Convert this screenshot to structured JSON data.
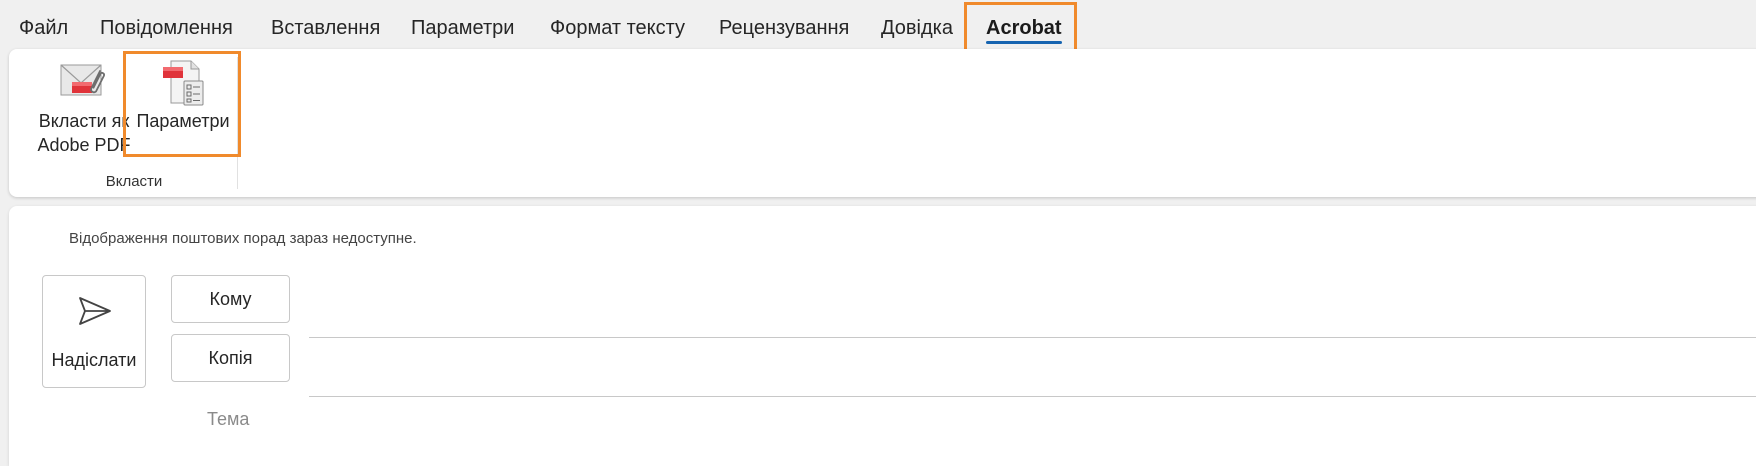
{
  "tabs": [
    {
      "label": "Файл"
    },
    {
      "label": "Повідомлення"
    },
    {
      "label": "Вставлення"
    },
    {
      "label": "Параметри"
    },
    {
      "label": "Формат тексту"
    },
    {
      "label": "Рецензування"
    },
    {
      "label": "Довідка"
    },
    {
      "label": "Acrobat",
      "active": true
    }
  ],
  "ribbon": {
    "attach_pdf": {
      "line1": "Вкласти як",
      "line2": "Adobe PDF",
      "icon": "envelope-paperclip-icon"
    },
    "options": {
      "label": "Параметри",
      "icon": "pdf-settings-icon"
    },
    "group_label": "Вкласти"
  },
  "compose": {
    "mailtips": "Відображення поштових порад зараз недоступне.",
    "send_label": "Надіслати",
    "to_label": "Кому",
    "cc_label": "Копія",
    "subject_placeholder": "Тема",
    "to_value": "",
    "cc_value": ""
  },
  "colors": {
    "highlight": "#f08a2c",
    "active_tab_underline": "#1664b0",
    "pdf_red": "#e0333a"
  }
}
